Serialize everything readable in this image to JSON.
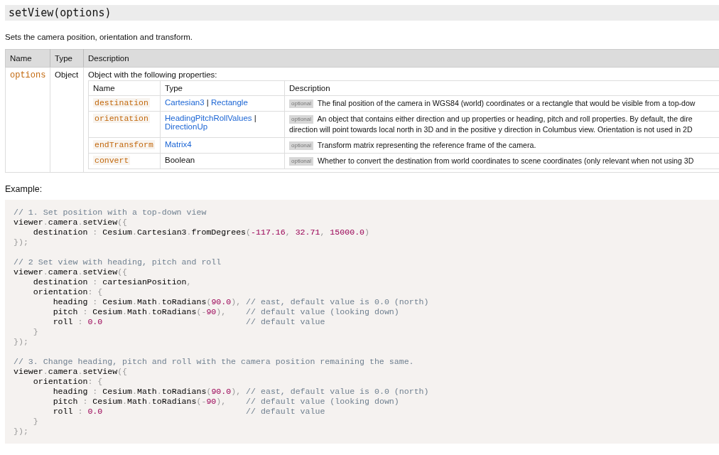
{
  "title": "setView(options)",
  "summary": "Sets the camera position, orientation and transform.",
  "params": {
    "columns": [
      "Name",
      "Type",
      "Description"
    ],
    "rows": [
      {
        "name": "options",
        "type": "Object",
        "description": "Object with the following properties:",
        "properties": {
          "columns": [
            "Name",
            "Type",
            "Description"
          ],
          "rows": [
            {
              "name": "destination",
              "type": [
                {
                  "kind": "link",
                  "text": "Cartesian3"
                },
                {
                  "kind": "sep",
                  "text": " | "
                },
                {
                  "kind": "link",
                  "text": "Rectangle"
                }
              ],
              "badge": "optional",
              "description": "The final position of the camera in WGS84 (world) coordinates or a rectangle that would be visible from a top-dow"
            },
            {
              "name": "orientation",
              "type": [
                {
                  "kind": "link",
                  "text": "HeadingPitchRollValues"
                },
                {
                  "kind": "sep",
                  "text": " | "
                },
                {
                  "kind": "link",
                  "text": "DirectionUp"
                }
              ],
              "badge": "optional",
              "description": "An object that contains either direction and up properties or heading, pitch and roll properties. By default, the dire",
              "description_2": "direction will point towards local north in 3D and in the positive y direction in Columbus view. Orientation is not used in 2D"
            },
            {
              "name": "endTransform",
              "type": [
                {
                  "kind": "link",
                  "text": "Matrix4"
                }
              ],
              "badge": "optional",
              "description": "Transform matrix representing the reference frame of the camera."
            },
            {
              "name": "convert",
              "type": [
                {
                  "kind": "plain",
                  "text": "Boolean"
                }
              ],
              "badge": "optional",
              "description": "Whether to convert the destination from world coordinates to scene coordinates (only relevant when not using 3D"
            }
          ]
        }
      }
    ]
  },
  "example": {
    "label": "Example:",
    "lines": [
      [
        {
          "kind": "comment",
          "text": "// 1. Set position with a top-down view"
        }
      ],
      [
        {
          "kind": "plain",
          "text": "viewer"
        },
        {
          "kind": "punct",
          "text": "."
        },
        {
          "kind": "plain",
          "text": "camera"
        },
        {
          "kind": "punct",
          "text": "."
        },
        {
          "kind": "plain",
          "text": "setView"
        },
        {
          "kind": "punct",
          "text": "({"
        }
      ],
      [
        {
          "kind": "plain",
          "text": "    destination "
        },
        {
          "kind": "punct",
          "text": ":"
        },
        {
          "kind": "plain",
          "text": " Cesium"
        },
        {
          "kind": "punct",
          "text": "."
        },
        {
          "kind": "plain",
          "text": "Cartesian3"
        },
        {
          "kind": "punct",
          "text": "."
        },
        {
          "kind": "plain",
          "text": "fromDegrees"
        },
        {
          "kind": "punct",
          "text": "("
        },
        {
          "kind": "number",
          "text": "-117.16"
        },
        {
          "kind": "punct",
          "text": ", "
        },
        {
          "kind": "number",
          "text": "32.71"
        },
        {
          "kind": "punct",
          "text": ", "
        },
        {
          "kind": "number",
          "text": "15000.0"
        },
        {
          "kind": "punct",
          "text": ")"
        }
      ],
      [
        {
          "kind": "punct",
          "text": "});"
        }
      ],
      [
        {
          "kind": "blank"
        }
      ],
      [
        {
          "kind": "comment",
          "text": "// 2 Set view with heading, pitch and roll"
        }
      ],
      [
        {
          "kind": "plain",
          "text": "viewer"
        },
        {
          "kind": "punct",
          "text": "."
        },
        {
          "kind": "plain",
          "text": "camera"
        },
        {
          "kind": "punct",
          "text": "."
        },
        {
          "kind": "plain",
          "text": "setView"
        },
        {
          "kind": "punct",
          "text": "({"
        }
      ],
      [
        {
          "kind": "plain",
          "text": "    destination "
        },
        {
          "kind": "punct",
          "text": ":"
        },
        {
          "kind": "plain",
          "text": " cartesianPosition"
        },
        {
          "kind": "punct",
          "text": ","
        }
      ],
      [
        {
          "kind": "plain",
          "text": "    orientation"
        },
        {
          "kind": "punct",
          "text": ": {"
        }
      ],
      [
        {
          "kind": "plain",
          "text": "        heading "
        },
        {
          "kind": "punct",
          "text": ":"
        },
        {
          "kind": "plain",
          "text": " Cesium"
        },
        {
          "kind": "punct",
          "text": "."
        },
        {
          "kind": "plain",
          "text": "Math"
        },
        {
          "kind": "punct",
          "text": "."
        },
        {
          "kind": "plain",
          "text": "toRadians"
        },
        {
          "kind": "punct",
          "text": "("
        },
        {
          "kind": "number",
          "text": "90.0"
        },
        {
          "kind": "punct",
          "text": "), "
        },
        {
          "kind": "comment",
          "text": "// east, default value is 0.0 (north)"
        }
      ],
      [
        {
          "kind": "plain",
          "text": "        pitch "
        },
        {
          "kind": "punct",
          "text": ":"
        },
        {
          "kind": "plain",
          "text": " Cesium"
        },
        {
          "kind": "punct",
          "text": "."
        },
        {
          "kind": "plain",
          "text": "Math"
        },
        {
          "kind": "punct",
          "text": "."
        },
        {
          "kind": "plain",
          "text": "toRadians"
        },
        {
          "kind": "punct",
          "text": "(-"
        },
        {
          "kind": "number",
          "text": "90"
        },
        {
          "kind": "punct",
          "text": "),    "
        },
        {
          "kind": "comment",
          "text": "// default value (looking down)"
        }
      ],
      [
        {
          "kind": "plain",
          "text": "        roll "
        },
        {
          "kind": "punct",
          "text": ":"
        },
        {
          "kind": "number",
          "text": " 0.0"
        },
        {
          "kind": "comment",
          "text": "                             // default value"
        }
      ],
      [
        {
          "kind": "punct",
          "text": "    }"
        }
      ],
      [
        {
          "kind": "punct",
          "text": "});"
        }
      ],
      [
        {
          "kind": "blank"
        }
      ],
      [
        {
          "kind": "comment",
          "text": "// 3. Change heading, pitch and roll with the camera position remaining the same."
        }
      ],
      [
        {
          "kind": "plain",
          "text": "viewer"
        },
        {
          "kind": "punct",
          "text": "."
        },
        {
          "kind": "plain",
          "text": "camera"
        },
        {
          "kind": "punct",
          "text": "."
        },
        {
          "kind": "plain",
          "text": "setView"
        },
        {
          "kind": "punct",
          "text": "({"
        }
      ],
      [
        {
          "kind": "plain",
          "text": "    orientation"
        },
        {
          "kind": "punct",
          "text": ": {"
        }
      ],
      [
        {
          "kind": "plain",
          "text": "        heading "
        },
        {
          "kind": "punct",
          "text": ":"
        },
        {
          "kind": "plain",
          "text": " Cesium"
        },
        {
          "kind": "punct",
          "text": "."
        },
        {
          "kind": "plain",
          "text": "Math"
        },
        {
          "kind": "punct",
          "text": "."
        },
        {
          "kind": "plain",
          "text": "toRadians"
        },
        {
          "kind": "punct",
          "text": "("
        },
        {
          "kind": "number",
          "text": "90.0"
        },
        {
          "kind": "punct",
          "text": "), "
        },
        {
          "kind": "comment",
          "text": "// east, default value is 0.0 (north)"
        }
      ],
      [
        {
          "kind": "plain",
          "text": "        pitch "
        },
        {
          "kind": "punct",
          "text": ":"
        },
        {
          "kind": "plain",
          "text": " Cesium"
        },
        {
          "kind": "punct",
          "text": "."
        },
        {
          "kind": "plain",
          "text": "Math"
        },
        {
          "kind": "punct",
          "text": "."
        },
        {
          "kind": "plain",
          "text": "toRadians"
        },
        {
          "kind": "punct",
          "text": "(-"
        },
        {
          "kind": "number",
          "text": "90"
        },
        {
          "kind": "punct",
          "text": "),    "
        },
        {
          "kind": "comment",
          "text": "// default value (looking down)"
        }
      ],
      [
        {
          "kind": "plain",
          "text": "        roll "
        },
        {
          "kind": "punct",
          "text": ":"
        },
        {
          "kind": "number",
          "text": " 0.0"
        },
        {
          "kind": "comment",
          "text": "                             // default value"
        }
      ],
      [
        {
          "kind": "punct",
          "text": "    }"
        }
      ],
      [
        {
          "kind": "punct",
          "text": "});"
        }
      ]
    ]
  }
}
